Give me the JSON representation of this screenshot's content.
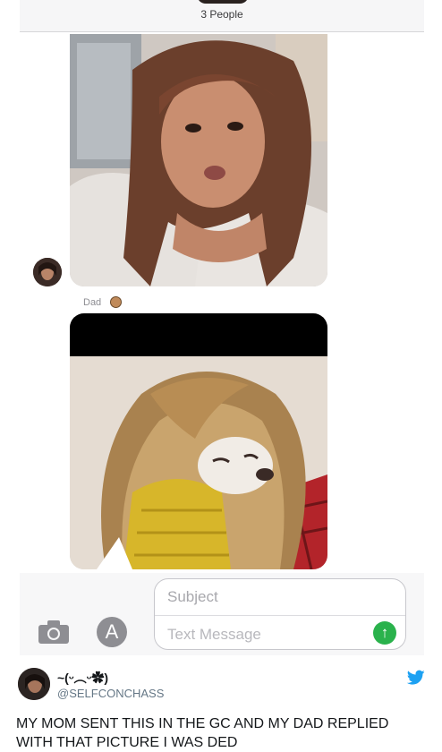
{
  "conversation": {
    "title": "3 People",
    "sender_label": "Dad"
  },
  "compose": {
    "subject_placeholder": "Subject",
    "text_placeholder": "Text Message",
    "appstore_glyph": "A",
    "send_glyph": "↑"
  },
  "tweet": {
    "display_name": "~(ᵕ︵ᵕ✿)",
    "handle": "@SELFCONCHASS",
    "text": "MY MOM SENT THIS IN THE GC AND MY DAD REPLIED WITH THAT PICTURE I WAS DED"
  },
  "colors": {
    "send_green": "#2ab24c",
    "twitter_blue": "#1da1f2",
    "subtitle_gray": "#8e8e93"
  },
  "icons": {
    "camera": "camera-icon",
    "appstore": "appstore-icon",
    "send": "send-arrow-icon",
    "twitter": "twitter-bird-icon"
  }
}
